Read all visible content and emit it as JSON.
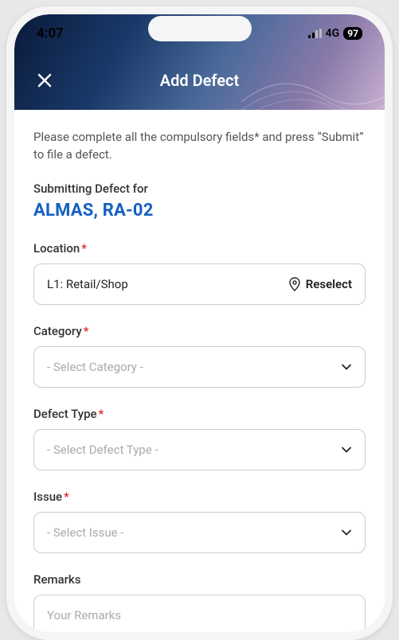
{
  "status": {
    "time": "4:07",
    "network": "4G",
    "battery": "97"
  },
  "header": {
    "title": "Add Defect"
  },
  "instruction": "Please complete all the compulsory fields* and press “Submit” to file a defect.",
  "submitting": {
    "label": "Submitting Defect for",
    "entity": "ALMAS, RA-02"
  },
  "fields": {
    "location": {
      "label": "Location",
      "value": "L1: Retail/Shop",
      "reselect": "Reselect"
    },
    "category": {
      "label": "Category",
      "placeholder": "- Select Category -"
    },
    "defect_type": {
      "label": "Defect Type",
      "placeholder": "- Select Defect Type -"
    },
    "issue": {
      "label": "Issue",
      "placeholder": "- Select Issue -"
    },
    "remarks": {
      "label": "Remarks",
      "placeholder": "Your Remarks"
    }
  }
}
